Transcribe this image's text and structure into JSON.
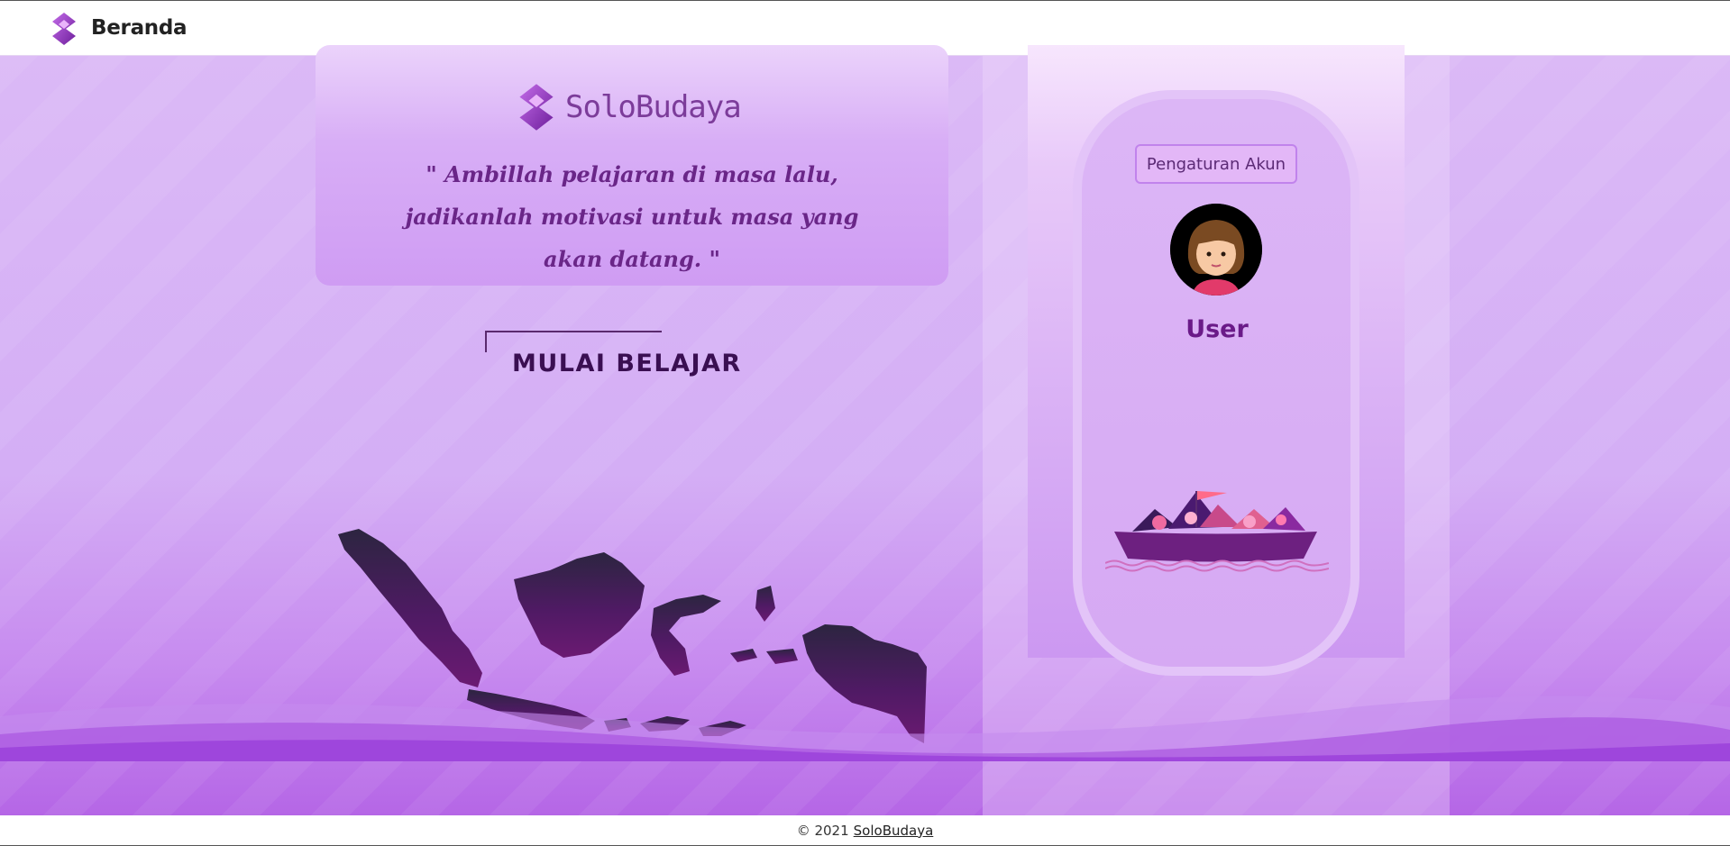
{
  "navbar": {
    "title": "Beranda",
    "logo_icon": "solobudaya-logo-icon"
  },
  "hero": {
    "brand_name": "SoloBudaya",
    "quote": "\" Ambillah pelajaran di masa lalu, jadikanlah motivasi untuk masa yang akan datang. \""
  },
  "start": {
    "title": "MULAI BELAJAR",
    "map_icon": "indonesia-map-icon"
  },
  "profile": {
    "settings_label": "Pengaturan Akun",
    "avatar_icon": "girl-avatar-icon",
    "username": "User",
    "illustration_icon": "culture-boat-icon"
  },
  "footer": {
    "copyright": "© 2021",
    "link_label": "SoloBudaya"
  },
  "colors": {
    "accent": "#8e44ad",
    "background": "#d4aef5",
    "text_dark": "#3a0f52"
  }
}
